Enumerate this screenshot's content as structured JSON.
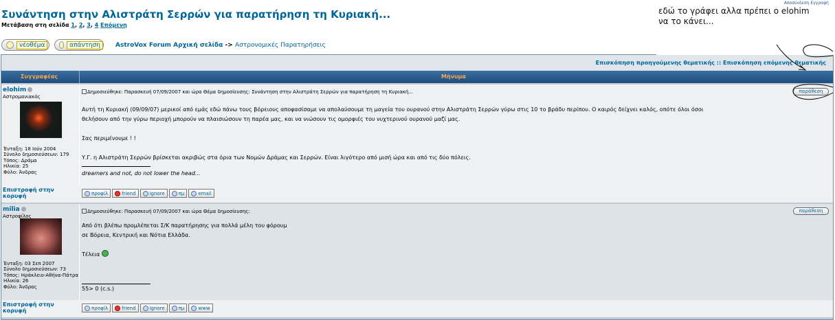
{
  "topic": {
    "title": "Συνάντηση στην Αλιστράτη Σερρών για παρατήρηση τη Κυριακή...",
    "pagination_label": "Μετάβαση στη σελίδα",
    "pages": [
      "1",
      "2",
      "3",
      "4"
    ],
    "next": "Επόμενη"
  },
  "buttons": {
    "new_topic": "νέοθέμα",
    "reply": "απάντηση"
  },
  "breadcrumb": {
    "home": "AstroVox Forum Αρχική σελίδα",
    "sep": " -> ",
    "section": "Αστρονομικές Παρατηρήσεις"
  },
  "topic_nav": "Επισκόπηση προηγούμενης θεματικής :: Επισκόπηση επόμενης θεματικής",
  "table_header": {
    "author": "Συγγραφέας",
    "message": "Μήνυμα"
  },
  "posts": [
    {
      "author": "elohim",
      "rank": "Αστρομανιακός",
      "meta": "Ένταξη: 18 Ιούν 2004\nΣύνολο δημοσιεύσεων: 179\nΤόπος: Δράμα\nΗλικία: 25\nΦύλο: Άνδρας",
      "header": "Δημοσιεύθηκε: Παρασκευή 07/09/2007 και ώρα     Θέμα δημοσίευσης: Συνάντηση στην Αλιστράτη Σερρών για παρατήρηση τη Κυριακή...",
      "quote_btn": "παράθεση",
      "body": [
        "Αυτή τη Κυριακή (09/09/07) μερικοί από εμάς εδώ πάνω τους βόρειους αποφασίσαμε να απολαύσουμε τη μαγεία του ουρανού στην Αλιστράτη Σερρών γύρω στις 10 το βράδυ περίπου. Ο καιρός δείχνει καλός, οπότε όλοι όσοι",
        "θελήσουν από την γύρω περιοχή μπορούν να πλαισιώσουν τη παρέα μας, και να νιώσουν τις ομορφιές του νυχτερινού ουρανού μαζί μας.",
        "",
        "Σας περιμένουμε ! !",
        "",
        "Υ.Γ. η Αλιστράτη Σερρών βρίσκεται ακριβώς στα όρια των Νομών Δράμας και Σερρών. Είναι λιγότερο από μισή ώρα και από τις δύο πόλεις."
      ],
      "signature": "dreamers and not, do not lower the head...",
      "back_to_top": "Επιστροφή στην κορυφή",
      "profile_buttons": [
        "προφίλ",
        "friend",
        "ignore",
        "πμ",
        "email"
      ]
    },
    {
      "author": "milia",
      "rank": "Αστροφίλος",
      "meta": "Ένταξη: 03 Σεπ 2007\nΣύνολο δημοσιεύσεων: 73\nΤόπος: Ηράκλειο-Αθήνα-Πάτρα\nΗλικία: 26\nΦύλο: Άνδρας",
      "header": "Δημοσιεύθηκε: Παρασκευή 07/09/2007 και ώρα     Θέμα δημοσίευσης:",
      "quote_btn": "παράθεση",
      "body": [
        "Από ότι βλέπω προμλέπεται Σ/Κ παρατήρησης για πολλά μέλη του φόρουμ",
        "σε Βόρεια, Κεντρική και Νότια Ελλάδα.",
        "",
        "Τέλεια"
      ],
      "signature": "55> 0 (c.s.)",
      "back_to_top": "Επιστροφή στην κορυφή",
      "profile_buttons": [
        "προφίλ",
        "friend",
        "ignore",
        "πμ",
        "www"
      ]
    }
  ],
  "annotation": {
    "text": "εδώ το γράφει αλλα πρέπει ο elohim να το κάνει...",
    "top_right_link": "Αποσύνδεση Εγγραφή"
  }
}
